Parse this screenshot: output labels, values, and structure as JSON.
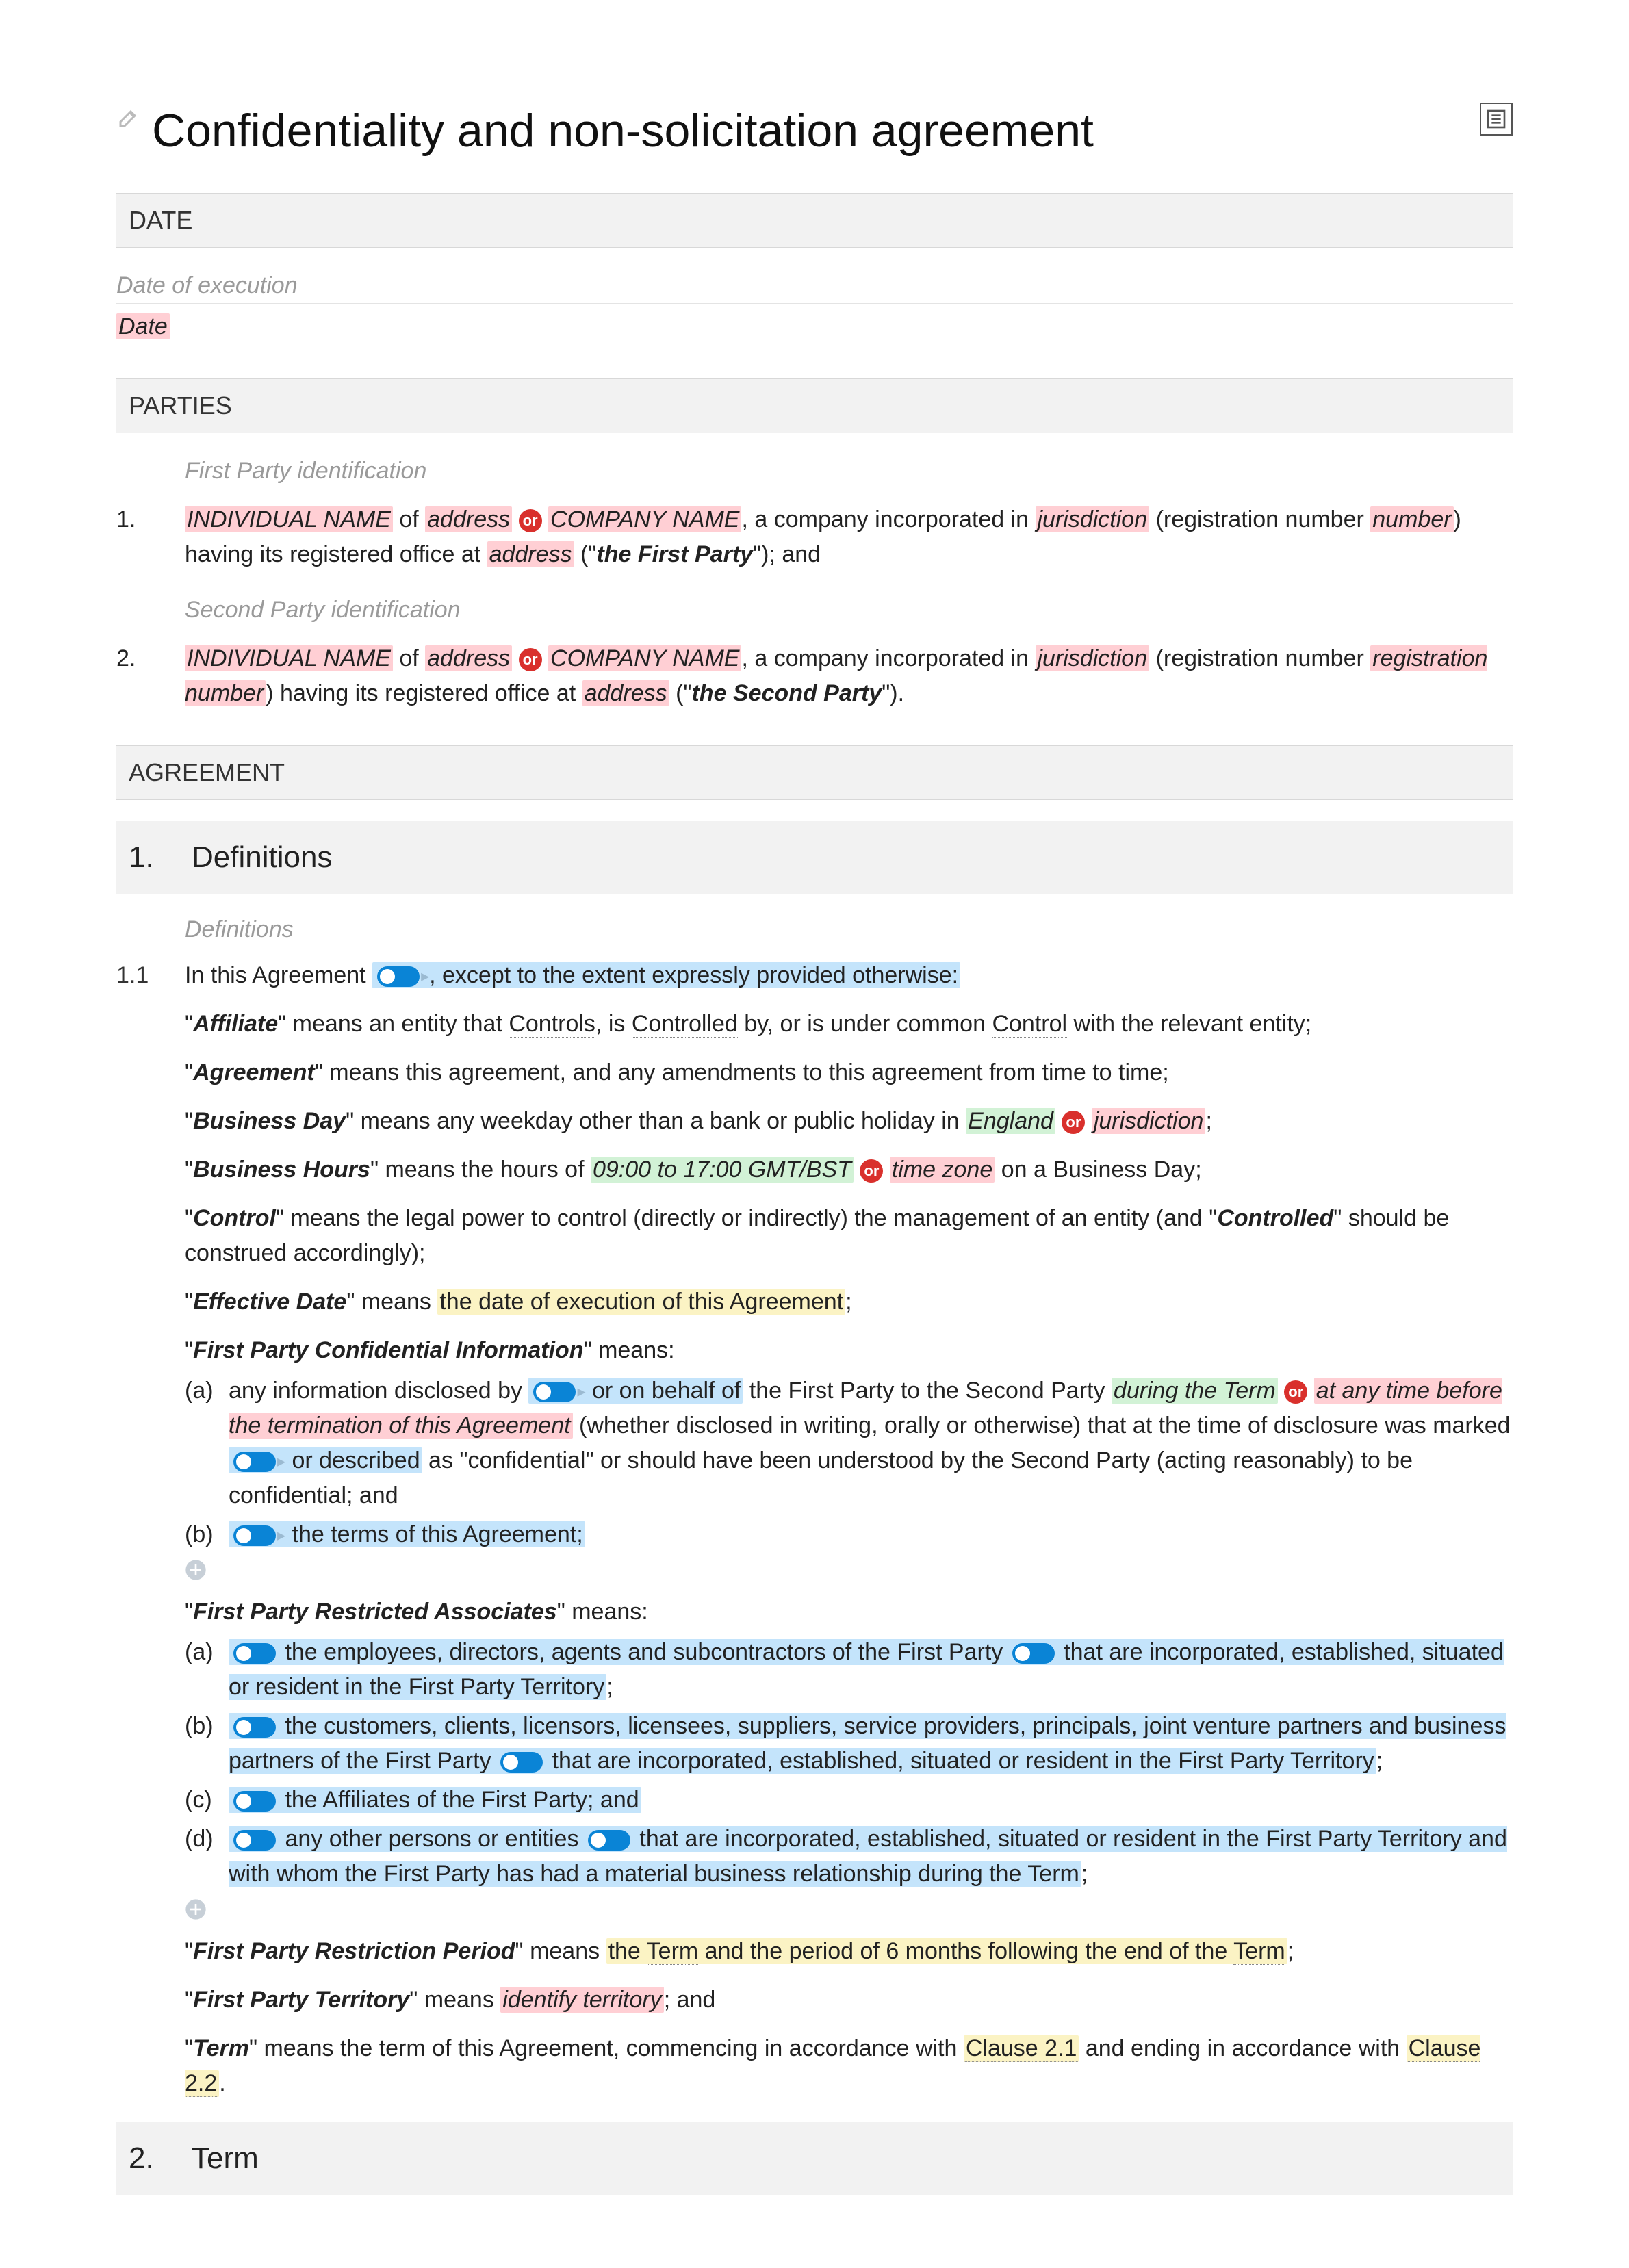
{
  "title": "Confidentiality and non-solicitation agreement",
  "sections": {
    "date": {
      "label": "DATE",
      "comment": "Date of execution",
      "value": "Date"
    },
    "parties": {
      "label": "PARTIES",
      "items": [
        {
          "num": "1.",
          "comment": "First Party identification",
          "name_ph": "INDIVIDUAL NAME",
          "of": " of ",
          "addr1_ph": "address",
          "company_ph": "COMPANY NAME",
          "incorp": ", a company incorporated in ",
          "juris_ph": "jurisdiction",
          "reg_open": " (registration number ",
          "reg_ph": "number",
          "reg_close": ") having its registered office at ",
          "addr2_ph": "address",
          "role_open": " (\"",
          "role": "the First Party",
          "role_close": "\"); and"
        },
        {
          "num": "2.",
          "comment": "Second Party identification",
          "name_ph": "INDIVIDUAL NAME",
          "of": " of ",
          "addr1_ph": "address",
          "company_ph": "COMPANY NAME",
          "incorp": ", a company incorporated in ",
          "juris_ph": "jurisdiction",
          "reg_open": " (registration number ",
          "reg_ph": "registration number",
          "reg_close": ") having its registered office at ",
          "addr2_ph": "address",
          "role_open": " (\"",
          "role": "the Second Party",
          "role_close": "\")."
        }
      ]
    },
    "agreement": {
      "label": "AGREEMENT"
    }
  },
  "clauses": {
    "c1": {
      "num": "1.",
      "title": "Definitions",
      "comment": "Definitions",
      "sub_num": "1.1",
      "intro_a": "In this Agreement",
      "intro_b": ", except to the extent expressly provided otherwise:",
      "defs": {
        "affiliate": {
          "term": "Affiliate",
          "pre": "\" means an entity that ",
          "u1": "Controls",
          "mid1": ", is ",
          "u2": "Controlled",
          "mid2": " by, or is under common ",
          "u3": "Control",
          "post": " with the relevant entity;"
        },
        "agreement": {
          "term": "Agreement",
          "body": "\" means this agreement, and any amendments to this agreement from time to time;"
        },
        "bday": {
          "term": "Business Day",
          "pre": "\" means any weekday other than a bank or public holiday in ",
          "opt1": "England",
          "opt2": "jurisdiction",
          "post": ";"
        },
        "bhours": {
          "term": "Business Hours",
          "pre": "\" means the hours of ",
          "opt1": "09:00 to 17:00 GMT/BST",
          "opt2": "time zone",
          "mid": " on a ",
          "u1": "Business Day",
          "post": ";"
        },
        "control": {
          "term": "Control",
          "pre": "\" means the legal power to control (directly or indirectly) the management of an entity (and \"",
          "term2": "Controlled",
          "post": "\" should be construed accordingly);"
        },
        "effdate": {
          "term": "Effective Date",
          "pre": "\" means ",
          "hl": "the date of execution of this Agreement",
          "post": ";"
        },
        "fpci": {
          "term": "First Party Confidential Information",
          "means": "\" means:",
          "a_label": "(a)",
          "a_pre": "any information disclosed by ",
          "a_hl1": "or on behalf of",
          "a_mid1": " the First Party to the Second Party ",
          "a_opt1": "during the Term",
          "a_opt2": "at any time before the termination of this Agreement",
          "a_mid2": " (whether disclosed in writing, orally or otherwise) that at the time of disclosure was marked ",
          "a_hl2": "or described",
          "a_post": " as \"confidential\" or should have been understood by the Second Party (acting reasonably) to be confidential; and",
          "b_label": "(b)",
          "b_hl": "the terms of this Agreement;"
        },
        "fpra": {
          "term": "First Party Restricted Associates",
          "means": "\" means:",
          "a_label": "(a)",
          "a_hl1": "the employees, directors, agents and subcontractors of the First Party",
          "a_hl2": " that are incorporated, established, situated or resident in the First Party Territory",
          "a_post": ";",
          "b_label": "(b)",
          "b_hl1": "the customers, clients, licensors, licensees, suppliers, service providers, principals, joint venture partners and business partners of the First Party",
          "b_hl2": " that are incorporated, established, situated or resident in the First Party Territory",
          "b_post": ";",
          "c_label": "(c)",
          "c_hl": "the Affiliates of the First Party; and",
          "d_label": "(d)",
          "d_hl1": "any other persons or entities",
          "d_hl2": " that are incorporated, established, situated or resident in the First Party Territory",
          "d_hl3": "and with whom the First Party has had a material business relationship during the ",
          "d_term": "Term",
          "d_post": ";"
        },
        "fprp": {
          "term": "First Party Restriction Period",
          "pre": "\" means ",
          "hl1": "the ",
          "u1": "Term",
          "hl2": " and the period of 6 months following the end of the ",
          "u2": "Term",
          "post": ";"
        },
        "fpt": {
          "term": "First Party Territory",
          "pre": "\" means ",
          "ph": "identify territory",
          "post": "; and"
        },
        "term": {
          "term": "Term",
          "pre": "\" means the term of this Agreement, commencing in accordance with ",
          "u1": "Clause 2.1",
          "mid": " and ending in accordance with ",
          "u2": "Clause 2.2",
          "post": "."
        }
      }
    },
    "c2": {
      "num": "2.",
      "title": "Term"
    }
  },
  "chips": {
    "or": "or"
  }
}
